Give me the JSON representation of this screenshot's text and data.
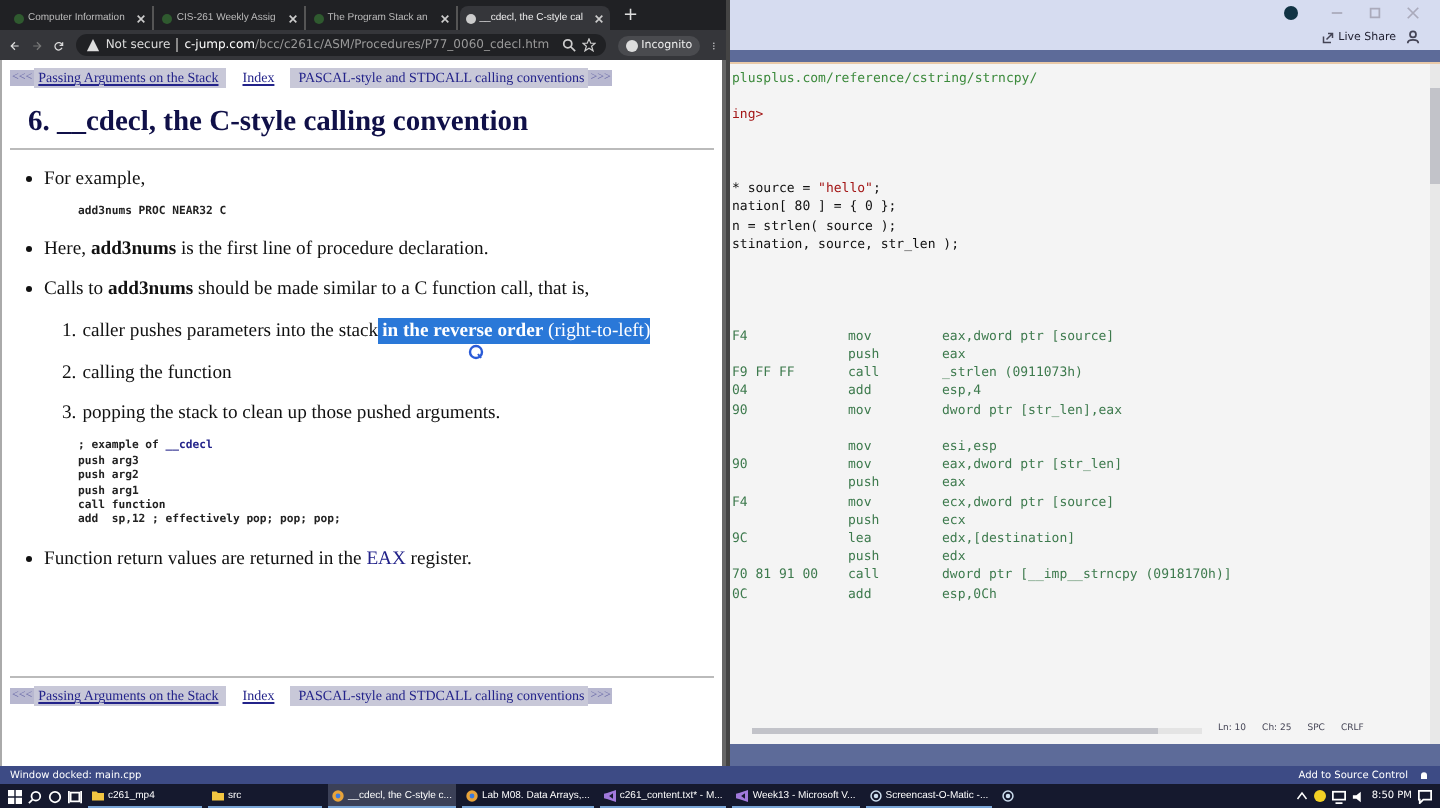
{
  "browser": {
    "tabs": [
      {
        "title": "Computer Information",
        "selected": false
      },
      {
        "title": "CIS-261 Weekly Assig",
        "selected": false
      },
      {
        "title": "The Program Stack an",
        "selected": false
      },
      {
        "title": "__cdecl, the C-style cal",
        "selected": true
      }
    ],
    "new_tab": "+",
    "url_warning": "Not secure",
    "url_domain": "c-jump.com",
    "url_path": "/bcc/c261c/ASM/Procedures/P77_0060_cdecl.htm",
    "profile": "Incognito"
  },
  "page": {
    "nav_top": {
      "prev": "<<<",
      "prev_link": "Passing Arguments on the Stack",
      "index": "Index",
      "next_link": "PASCAL-style and STDCALL calling conventions",
      "next": ">>>"
    },
    "heading": "6. __cdecl, the C-style calling convention",
    "bullets": [
      {
        "parts": [
          {
            "text": "For example,",
            "kind": "plain"
          }
        ],
        "code": [
          [
            {
              "text": "add3nums PROC NEAR32 C",
              "kind": "plain"
            }
          ]
        ]
      },
      {
        "parts": [
          {
            "text": "Here, **add3nums** is the first line of procedure declaration.",
            "kind": "plain"
          }
        ]
      },
      {
        "parts": [
          {
            "text": "Calls to **add3nums** should be made similar to a C function call, that is,",
            "kind": "plain"
          }
        ],
        "steps": [
          {
            "number": "1.",
            "text": "caller pushes parameters into the stack",
            "highlight": {
              "text": "**in the reverse order** (right-to-left)",
              "selected": true
            }
          },
          {
            "number": "2.",
            "text": "calling the function"
          },
          {
            "number": "3.",
            "text": "popping the stack to clean up those pushed arguments."
          }
        ],
        "code": [
          [
            {
              "text": "; example of ",
              "kind": "plain"
            },
            {
              "text": "__cdecl",
              "kind": "keyword"
            }
          ],
          [
            {
              "text": "push arg3",
              "kind": "plain"
            }
          ],
          [
            {
              "text": "push arg2",
              "kind": "plain"
            }
          ],
          [
            {
              "text": "push arg1",
              "kind": "plain"
            }
          ],
          [
            {
              "text": "call function",
              "kind": "plain"
            }
          ],
          [
            {
              "text": "add  sp,12 ; effectively pop; pop; pop;",
              "kind": "plain"
            }
          ]
        ]
      },
      {
        "parts": [
          {
            "text": "Function return values are returned in the ",
            "kind": "plain"
          },
          {
            "text": "EAX",
            "kind": "link"
          },
          {
            "text": " register.",
            "kind": "plain"
          }
        ]
      }
    ],
    "nav_bottom": {
      "prev": "<<<",
      "prev_link": "Passing Arguments on the Stack",
      "index": "Index",
      "next_link": "PASCAL-style and STDCALL calling conventions",
      "next": ">>>"
    }
  },
  "editor": {
    "live_share": "Live Share",
    "source_groups": [
      [
        [
          {
            "text": "plusplus.com/reference/cstring/strncpy/",
            "kind": "comment"
          }
        ]
      ],
      [
        [
          {
            "text": "ing>",
            "kind": "string"
          }
        ]
      ],
      [
        [
          {
            "text": "* source = ",
            "kind": "code"
          },
          {
            "text": "\"hello\"",
            "kind": "string"
          },
          {
            "text": ";",
            "kind": "code"
          }
        ],
        [
          {
            "text": "nation[ 80 ] = { 0 };",
            "kind": "code"
          }
        ],
        [
          {
            "text": "n = strlen( source );",
            "kind": "code"
          }
        ],
        [
          {
            "text": "stination, source, str_len );",
            "kind": "code"
          }
        ]
      ]
    ],
    "disasm_groups": [
      [
        {
          "bytes": "F4",
          "op": "mov",
          "args": "eax,dword ptr [source]"
        },
        {
          "op": "push",
          "args": "eax"
        },
        {
          "bytes": "F9 FF FF",
          "op": "call",
          "args": "_strlen (0911073h)"
        },
        {
          "bytes": "04",
          "op": "add",
          "args": "esp,4"
        },
        {
          "bytes": "90",
          "op": "mov",
          "args": "dword ptr [str_len],eax"
        }
      ],
      [
        {
          "op": "mov",
          "args": "esi,esp"
        },
        {
          "bytes": "90",
          "op": "mov",
          "args": "eax,dword ptr [str_len]"
        },
        {
          "op": "push",
          "args": "eax"
        },
        {
          "bytes": "F4",
          "op": "mov",
          "args": "ecx,dword ptr [source]"
        },
        {
          "op": "push",
          "args": "ecx"
        },
        {
          "bytes": "9C",
          "op": "lea",
          "args": "edx,[destination]"
        },
        {
          "op": "push",
          "args": "edx"
        },
        {
          "bytes": "70 81 91 00",
          "op": "call",
          "args": "dword ptr [__imp__strncpy (0918170h)]"
        },
        {
          "bytes": "0C",
          "op": "add",
          "args": "esp,0Ch"
        }
      ]
    ],
    "status": [
      "Ln: 10",
      "Ch: 25",
      "SPC",
      "CRLF"
    ]
  },
  "status_bar": {
    "left": "Window docked: main.cpp",
    "right": "Add to Source Control"
  },
  "taskbar": {
    "apps": [
      {
        "label": "c261_mp4",
        "kind": "folder",
        "selected": false
      },
      {
        "label": "src",
        "kind": "folder",
        "selected": false
      },
      {
        "label": "__cdecl, the C-style c...",
        "kind": "browser",
        "selected": true
      },
      {
        "label": "Lab M08. Data Arrays,...",
        "kind": "browser",
        "selected": false
      },
      {
        "label": "c261_content.txt* - M...",
        "kind": "vs",
        "selected": false
      },
      {
        "label": "Week13 - Microsoft V...",
        "kind": "vs",
        "selected": false
      },
      {
        "label": "Screencast-O-Matic -...",
        "kind": "record",
        "selected": false
      },
      {
        "kind": "record",
        "selected": false
      }
    ],
    "clock": "8:50 PM"
  }
}
